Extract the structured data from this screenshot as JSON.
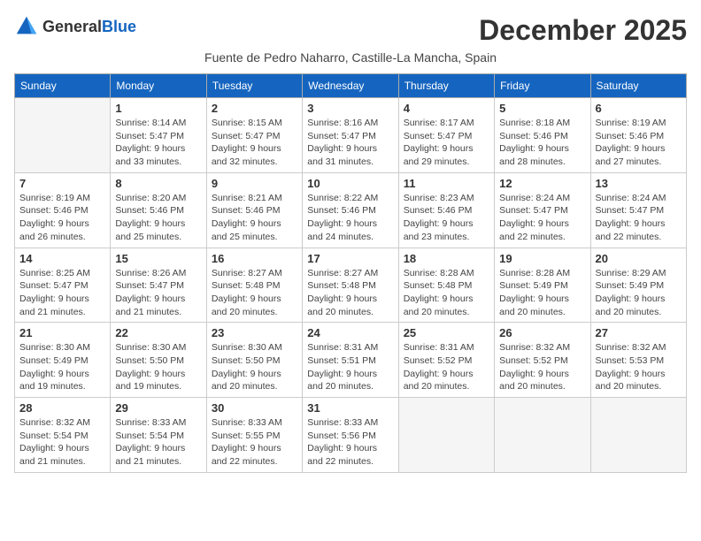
{
  "logo": {
    "text_general": "General",
    "text_blue": "Blue"
  },
  "title": "December 2025",
  "subtitle": "Fuente de Pedro Naharro, Castille-La Mancha, Spain",
  "weekdays": [
    "Sunday",
    "Monday",
    "Tuesday",
    "Wednesday",
    "Thursday",
    "Friday",
    "Saturday"
  ],
  "weeks": [
    [
      {
        "day": "",
        "info": ""
      },
      {
        "day": "1",
        "info": "Sunrise: 8:14 AM\nSunset: 5:47 PM\nDaylight: 9 hours\nand 33 minutes."
      },
      {
        "day": "2",
        "info": "Sunrise: 8:15 AM\nSunset: 5:47 PM\nDaylight: 9 hours\nand 32 minutes."
      },
      {
        "day": "3",
        "info": "Sunrise: 8:16 AM\nSunset: 5:47 PM\nDaylight: 9 hours\nand 31 minutes."
      },
      {
        "day": "4",
        "info": "Sunrise: 8:17 AM\nSunset: 5:47 PM\nDaylight: 9 hours\nand 29 minutes."
      },
      {
        "day": "5",
        "info": "Sunrise: 8:18 AM\nSunset: 5:46 PM\nDaylight: 9 hours\nand 28 minutes."
      },
      {
        "day": "6",
        "info": "Sunrise: 8:19 AM\nSunset: 5:46 PM\nDaylight: 9 hours\nand 27 minutes."
      }
    ],
    [
      {
        "day": "7",
        "info": "Sunrise: 8:19 AM\nSunset: 5:46 PM\nDaylight: 9 hours\nand 26 minutes."
      },
      {
        "day": "8",
        "info": "Sunrise: 8:20 AM\nSunset: 5:46 PM\nDaylight: 9 hours\nand 25 minutes."
      },
      {
        "day": "9",
        "info": "Sunrise: 8:21 AM\nSunset: 5:46 PM\nDaylight: 9 hours\nand 25 minutes."
      },
      {
        "day": "10",
        "info": "Sunrise: 8:22 AM\nSunset: 5:46 PM\nDaylight: 9 hours\nand 24 minutes."
      },
      {
        "day": "11",
        "info": "Sunrise: 8:23 AM\nSunset: 5:46 PM\nDaylight: 9 hours\nand 23 minutes."
      },
      {
        "day": "12",
        "info": "Sunrise: 8:24 AM\nSunset: 5:47 PM\nDaylight: 9 hours\nand 22 minutes."
      },
      {
        "day": "13",
        "info": "Sunrise: 8:24 AM\nSunset: 5:47 PM\nDaylight: 9 hours\nand 22 minutes."
      }
    ],
    [
      {
        "day": "14",
        "info": "Sunrise: 8:25 AM\nSunset: 5:47 PM\nDaylight: 9 hours\nand 21 minutes."
      },
      {
        "day": "15",
        "info": "Sunrise: 8:26 AM\nSunset: 5:47 PM\nDaylight: 9 hours\nand 21 minutes."
      },
      {
        "day": "16",
        "info": "Sunrise: 8:27 AM\nSunset: 5:48 PM\nDaylight: 9 hours\nand 20 minutes."
      },
      {
        "day": "17",
        "info": "Sunrise: 8:27 AM\nSunset: 5:48 PM\nDaylight: 9 hours\nand 20 minutes."
      },
      {
        "day": "18",
        "info": "Sunrise: 8:28 AM\nSunset: 5:48 PM\nDaylight: 9 hours\nand 20 minutes."
      },
      {
        "day": "19",
        "info": "Sunrise: 8:28 AM\nSunset: 5:49 PM\nDaylight: 9 hours\nand 20 minutes."
      },
      {
        "day": "20",
        "info": "Sunrise: 8:29 AM\nSunset: 5:49 PM\nDaylight: 9 hours\nand 20 minutes."
      }
    ],
    [
      {
        "day": "21",
        "info": "Sunrise: 8:30 AM\nSunset: 5:49 PM\nDaylight: 9 hours\nand 19 minutes."
      },
      {
        "day": "22",
        "info": "Sunrise: 8:30 AM\nSunset: 5:50 PM\nDaylight: 9 hours\nand 19 minutes."
      },
      {
        "day": "23",
        "info": "Sunrise: 8:30 AM\nSunset: 5:50 PM\nDaylight: 9 hours\nand 20 minutes."
      },
      {
        "day": "24",
        "info": "Sunrise: 8:31 AM\nSunset: 5:51 PM\nDaylight: 9 hours\nand 20 minutes."
      },
      {
        "day": "25",
        "info": "Sunrise: 8:31 AM\nSunset: 5:52 PM\nDaylight: 9 hours\nand 20 minutes."
      },
      {
        "day": "26",
        "info": "Sunrise: 8:32 AM\nSunset: 5:52 PM\nDaylight: 9 hours\nand 20 minutes."
      },
      {
        "day": "27",
        "info": "Sunrise: 8:32 AM\nSunset: 5:53 PM\nDaylight: 9 hours\nand 20 minutes."
      }
    ],
    [
      {
        "day": "28",
        "info": "Sunrise: 8:32 AM\nSunset: 5:54 PM\nDaylight: 9 hours\nand 21 minutes."
      },
      {
        "day": "29",
        "info": "Sunrise: 8:33 AM\nSunset: 5:54 PM\nDaylight: 9 hours\nand 21 minutes."
      },
      {
        "day": "30",
        "info": "Sunrise: 8:33 AM\nSunset: 5:55 PM\nDaylight: 9 hours\nand 22 minutes."
      },
      {
        "day": "31",
        "info": "Sunrise: 8:33 AM\nSunset: 5:56 PM\nDaylight: 9 hours\nand 22 minutes."
      },
      {
        "day": "",
        "info": ""
      },
      {
        "day": "",
        "info": ""
      },
      {
        "day": "",
        "info": ""
      }
    ]
  ]
}
